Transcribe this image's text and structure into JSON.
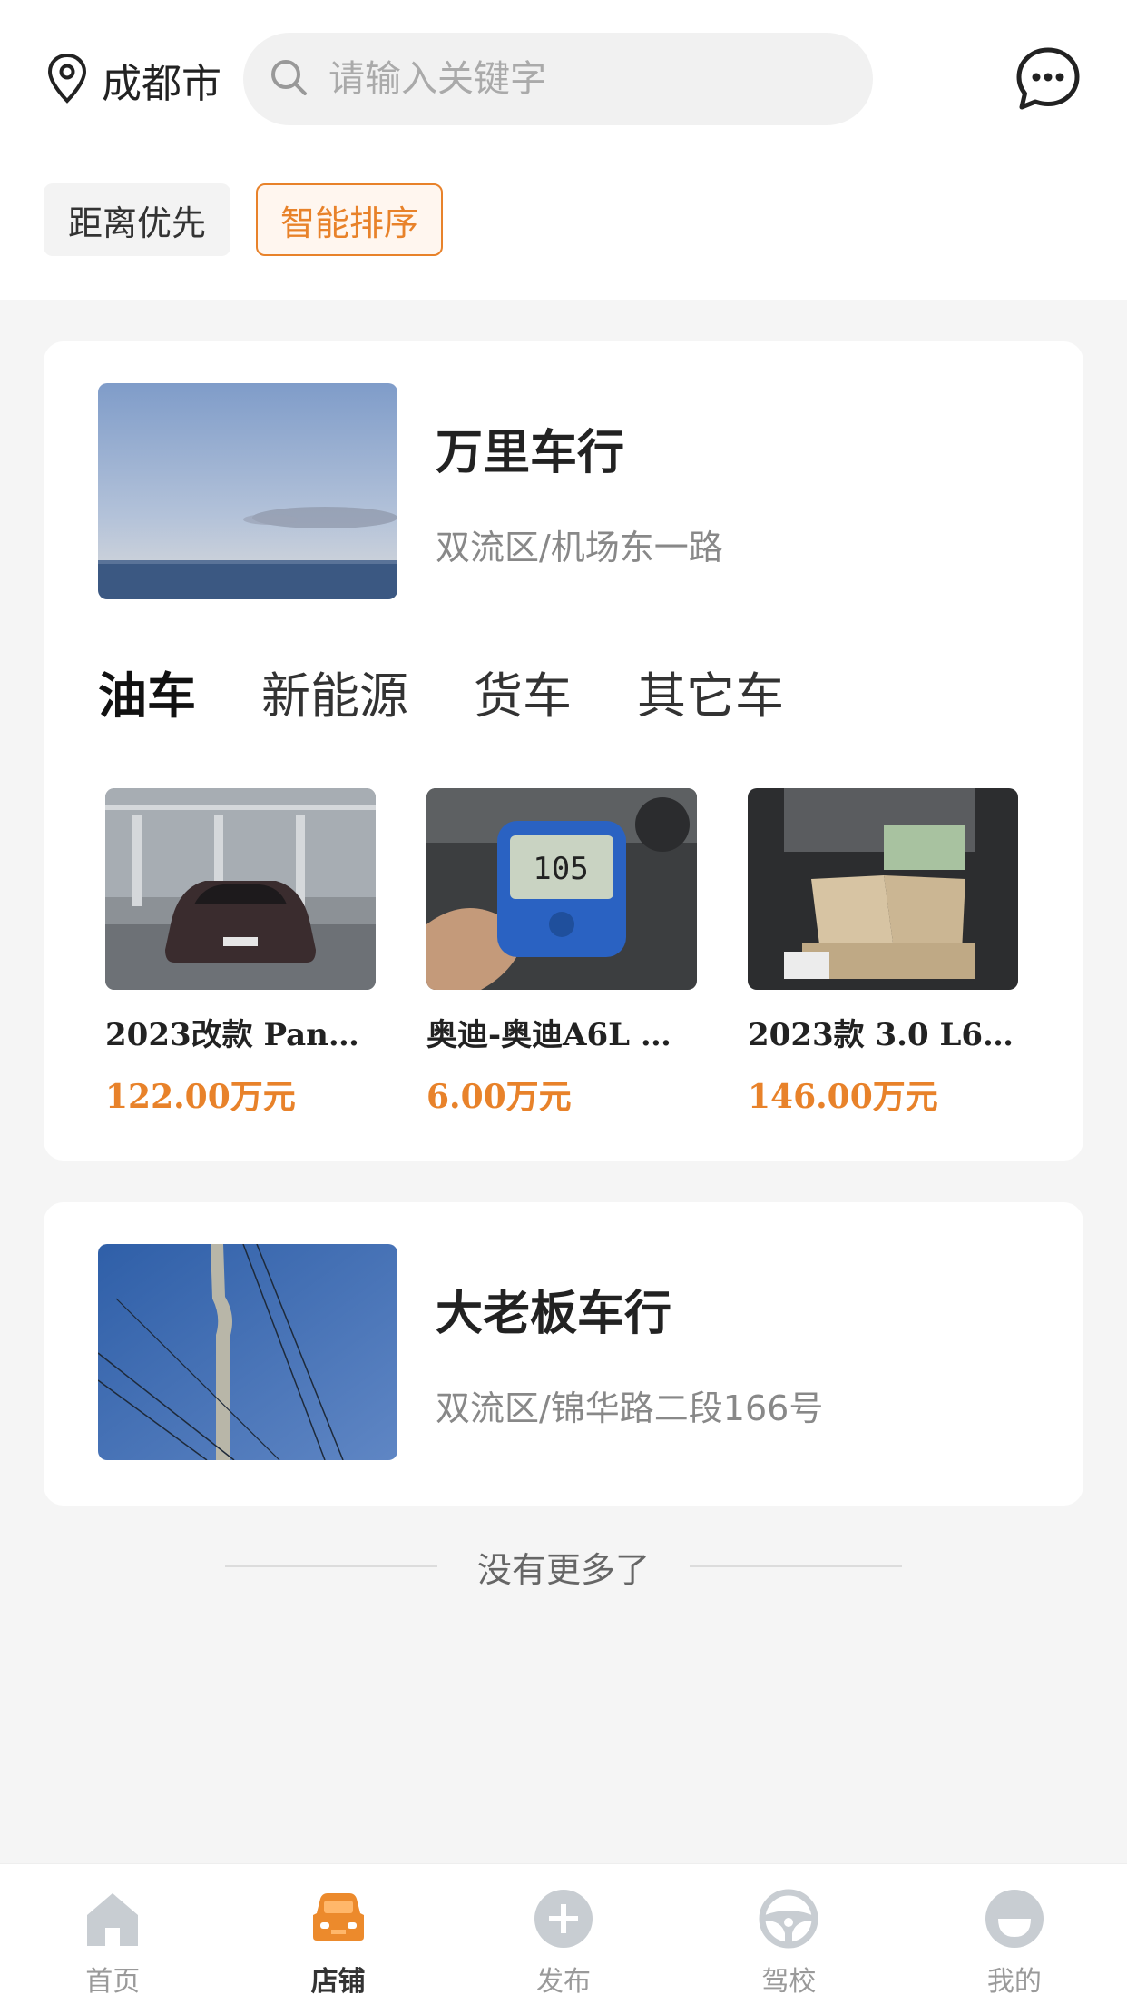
{
  "header": {
    "city": "成都市",
    "search_placeholder": "请输入关键字",
    "location_icon": "location-pin-icon",
    "search_icon": "search-icon",
    "message_icon": "chat-bubble-icon"
  },
  "sort": {
    "options": [
      "距离优先",
      "智能排序"
    ],
    "active": "智能排序"
  },
  "shops": [
    {
      "name": "万里车行",
      "address": "双流区/机场东一路",
      "tabs": [
        "油车",
        "新能源",
        "货车",
        "其它车"
      ],
      "active_tab": "油车",
      "cars": [
        {
          "title": "2023改款 Pana…",
          "price": "122.00万元"
        },
        {
          "title": "奥迪-奥迪A6L …",
          "price": "6.00万元"
        },
        {
          "title": "2023款 3.0 L6 …",
          "price": "146.00万元"
        }
      ]
    },
    {
      "name": "大老板车行",
      "address": "双流区/锦华路二段166号"
    }
  ],
  "footer_note": "没有更多了",
  "tabbar": {
    "items": [
      "首页",
      "店铺",
      "发布",
      "驾校",
      "我的"
    ],
    "active": "店铺"
  },
  "colors": {
    "accent": "#e8822a",
    "background": "#f5f5f5",
    "inactive_icon": "#c8cdd2"
  }
}
